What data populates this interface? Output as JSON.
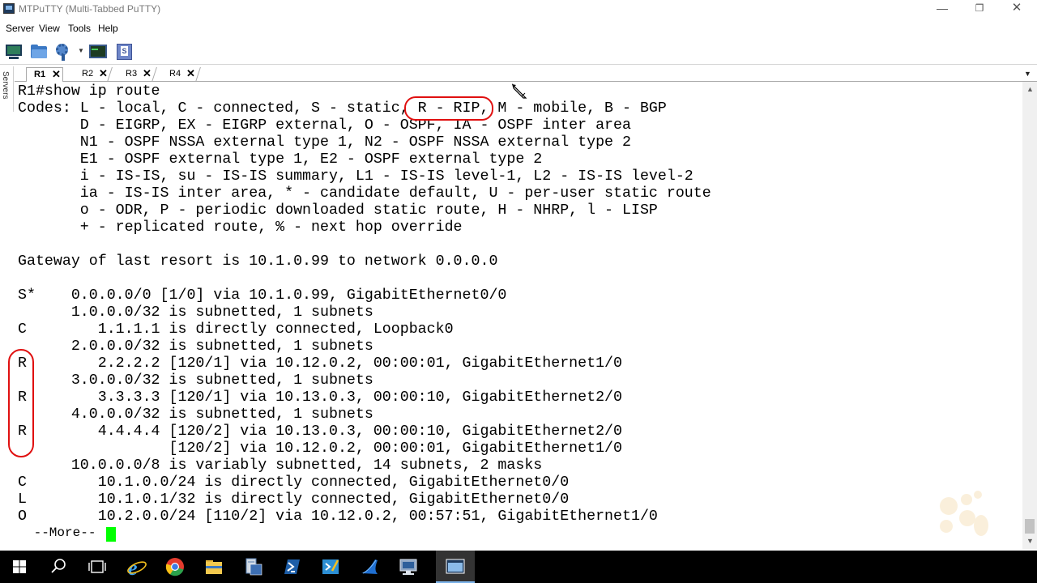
{
  "window": {
    "title": "MTPuTTY (Multi-Tabbed PuTTY)"
  },
  "menu": {
    "items": [
      "Server",
      "View",
      "Tools",
      "Help"
    ]
  },
  "side_panel": {
    "label": "Servers"
  },
  "tabs": [
    {
      "label": "R1",
      "active": true
    },
    {
      "label": "R2",
      "active": false
    },
    {
      "label": "R3",
      "active": false
    },
    {
      "label": "R4",
      "active": false
    }
  ],
  "terminal": {
    "lines": [
      "R1#show ip route",
      "Codes: L - local, C - connected, S - static, R - RIP, M - mobile, B - BGP",
      "       D - EIGRP, EX - EIGRP external, O - OSPF, IA - OSPF inter area",
      "       N1 - OSPF NSSA external type 1, N2 - OSPF NSSA external type 2",
      "       E1 - OSPF external type 1, E2 - OSPF external type 2",
      "       i - IS-IS, su - IS-IS summary, L1 - IS-IS level-1, L2 - IS-IS level-2",
      "       ia - IS-IS inter area, * - candidate default, U - per-user static route",
      "       o - ODR, P - periodic downloaded static route, H - NHRP, l - LISP",
      "       + - replicated route, % - next hop override",
      "",
      "Gateway of last resort is 10.1.0.99 to network 0.0.0.0",
      "",
      "S*    0.0.0.0/0 [1/0] via 10.1.0.99, GigabitEthernet0/0",
      "      1.0.0.0/32 is subnetted, 1 subnets",
      "C        1.1.1.1 is directly connected, Loopback0",
      "      2.0.0.0/32 is subnetted, 1 subnets",
      "R        2.2.2.2 [120/1] via 10.12.0.2, 00:00:01, GigabitEthernet1/0",
      "      3.0.0.0/32 is subnetted, 1 subnets",
      "R        3.3.3.3 [120/1] via 10.13.0.3, 00:00:10, GigabitEthernet2/0",
      "      4.0.0.0/32 is subnetted, 1 subnets",
      "R        4.4.4.4 [120/2] via 10.13.0.3, 00:00:10, GigabitEthernet2/0",
      "                 [120/2] via 10.12.0.2, 00:00:01, GigabitEthernet1/0",
      "      10.0.0.0/8 is variably subnetted, 14 subnets, 2 masks",
      "C        10.1.0.0/24 is directly connected, GigabitEthernet0/0",
      "L        10.1.0.1/32 is directly connected, GigabitEthernet0/0",
      "O        10.2.0.0/24 [110/2] via 10.12.0.2, 00:57:51, GigabitEthernet1/0"
    ],
    "more_prompt": " --More-- "
  },
  "icons": {
    "toolbar": [
      "connect-computer-icon",
      "open-folder-icon",
      "settings-gear-icon",
      "putty-console-icon",
      "script-icon"
    ],
    "taskbar": [
      "windows-start-icon",
      "search-icon",
      "task-view-icon",
      "internet-explorer-icon",
      "chrome-icon",
      "file-explorer-icon",
      "server-manager-icon",
      "powershell-icon",
      "visual-studio-code-icon",
      "remote-desktop-icon",
      "mtputty-icon"
    ]
  },
  "colors": {
    "annotation": "#e01010",
    "cursor": "#00ff00",
    "taskbar": "#000000"
  }
}
